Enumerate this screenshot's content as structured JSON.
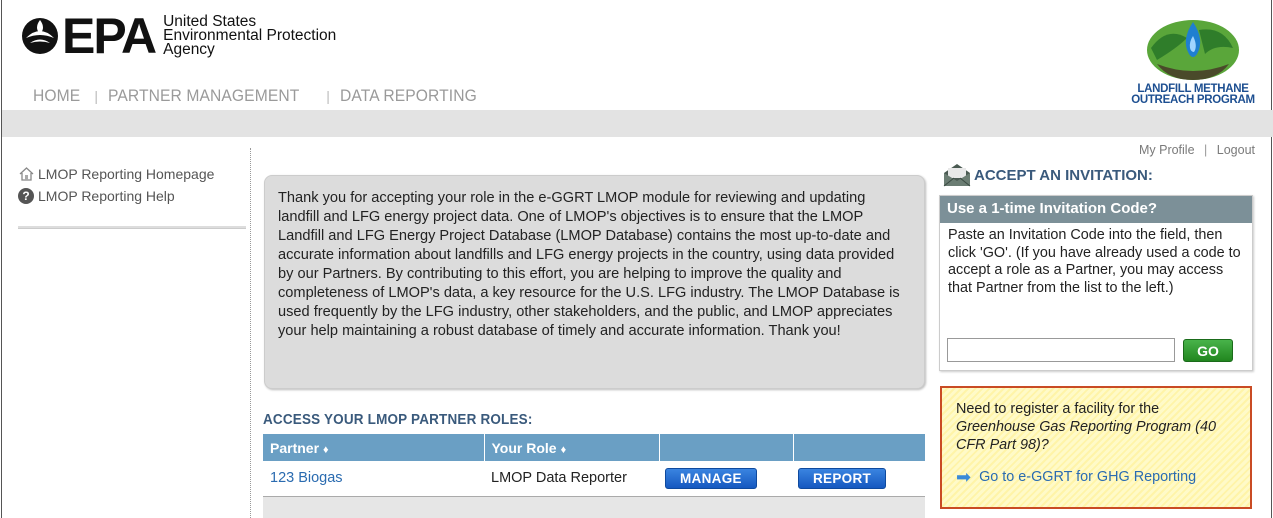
{
  "header": {
    "epa_letters": "EPA",
    "agency_line1": "United States",
    "agency_line2": "Environmental Protection",
    "agency_line3": "Agency",
    "lmop_line1": "LANDFILL METHANE",
    "lmop_line2": "OUTREACH PROGRAM"
  },
  "nav": {
    "items": [
      "HOME",
      "PARTNER MANAGEMENT",
      "DATA REPORTING"
    ]
  },
  "profile": {
    "my_profile": "My Profile",
    "separator": "|",
    "logout": "Logout"
  },
  "sidebar": {
    "items": [
      {
        "label": "LMOP Reporting Homepage",
        "icon": "home-icon"
      },
      {
        "label": "LMOP Reporting Help",
        "icon": "help-icon"
      }
    ]
  },
  "intro": {
    "text": "Thank you for accepting your role in the e-GGRT LMOP module for reviewing and updating landfill and LFG energy project data. One of LMOP's objectives is to ensure that the LMOP Landfill and LFG Energy Project Database (LMOP Database) contains the most up-to-date and accurate information about landfills and LFG energy projects in the country, using data provided by our Partners. By contributing to this effort, you are helping to improve the quality and completeness of LMOP's data, a key resource for the U.S. LFG industry. The LMOP Database is used frequently by the LFG industry, other stakeholders, and the public, and LMOP appreciates your help maintaining a robust database of timely and accurate information. Thank you!"
  },
  "roles": {
    "heading": "ACCESS YOUR LMOP PARTNER ROLES:",
    "columns": [
      "Partner",
      "Your Role",
      "",
      ""
    ],
    "sort_glyph": "♦",
    "rows": [
      {
        "partner": "123 Biogas",
        "role": "LMOP Data Reporter",
        "manage": "MANAGE",
        "report": "REPORT"
      }
    ]
  },
  "invitation": {
    "title": "ACCEPT AN INVITATION:",
    "box_header": "Use a 1-time Invitation Code?",
    "body": "Paste an Invitation Code into the field, then click 'GO'. (If you have already used a code to accept a role as a Partner, you may access that Partner from the list to the left.)",
    "input_value": "",
    "go_label": "GO"
  },
  "ghg": {
    "line1": "Need to register a facility for the",
    "line2": "Greenhouse Gas Reporting Program (40 CFR Part 98)?",
    "link": "Go to e-GGRT for GHG Reporting"
  },
  "colors": {
    "table_header": "#6a9fc4",
    "heading_blue": "#3a5a7c",
    "link_blue": "#2a6bb0",
    "go_green": "#21861f",
    "ghg_border": "#c94b24"
  }
}
